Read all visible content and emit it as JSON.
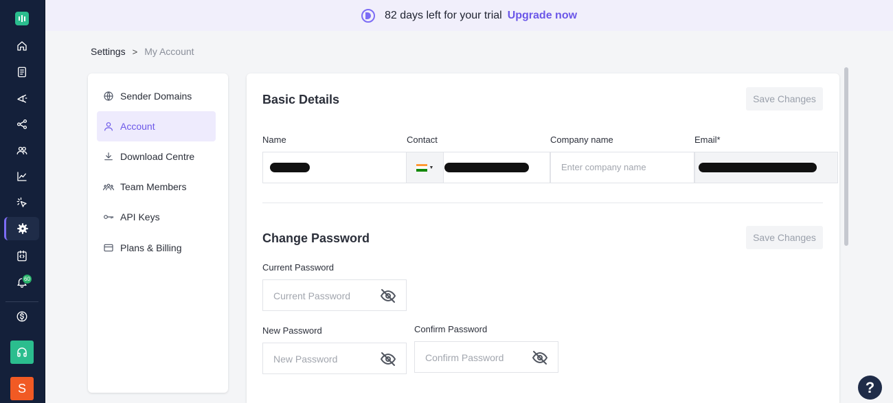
{
  "trial_banner": {
    "text": "82 days left for your trial",
    "link": "Upgrade now"
  },
  "breadcrumb": {
    "root": "Settings",
    "separator": ">",
    "current": "My Account"
  },
  "rail": {
    "notification_count": "60",
    "avatar_letter": "S"
  },
  "subnav": {
    "items": [
      {
        "label": "Sender Domains",
        "icon": "globe-icon"
      },
      {
        "label": "Account",
        "icon": "user-icon",
        "active": true
      },
      {
        "label": "Download Centre",
        "icon": "download-icon"
      },
      {
        "label": "Team Members",
        "icon": "team-icon"
      },
      {
        "label": "API Keys",
        "icon": "key-icon"
      },
      {
        "label": "Plans & Billing",
        "icon": "card-icon"
      }
    ]
  },
  "basic_details": {
    "title": "Basic Details",
    "save_label": "Save Changes",
    "name_label": "Name",
    "contact_label": "Contact",
    "company_label": "Company name",
    "company_placeholder": "Enter company name",
    "email_label": "Email*"
  },
  "change_password": {
    "title": "Change Password",
    "save_label": "Save Changes",
    "current_label": "Current Password",
    "current_placeholder": "Current Password",
    "new_label": "New Password",
    "new_placeholder": "New Password",
    "confirm_label": "Confirm Password",
    "confirm_placeholder": "Confirm Password"
  },
  "help": {
    "label": "?"
  },
  "colors": {
    "accent": "#6b57e8",
    "rail_bg": "#14203a",
    "brand_green": "#2bbd8e",
    "avatar_orange": "#f15a24"
  }
}
